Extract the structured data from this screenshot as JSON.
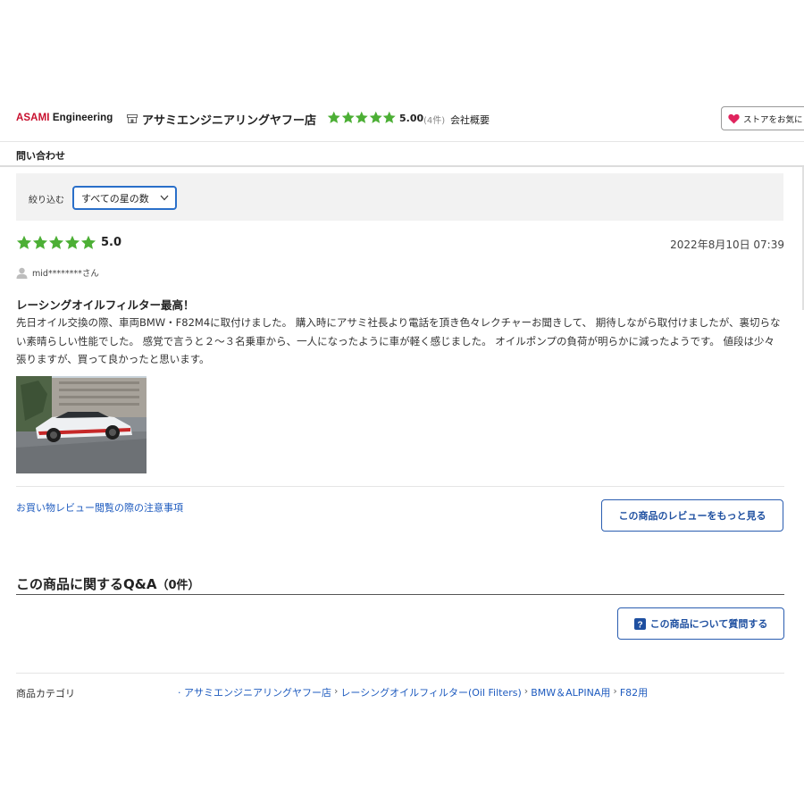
{
  "store": {
    "logo_part1": "ASAMI",
    "logo_part2": " Engineering",
    "icon": "store-icon",
    "name": "アサミエンジニアリングヤフー店",
    "rating": "5.00",
    "review_count": "(4件)",
    "company_link": "会社概要",
    "favorite_button": "ストアをお気に"
  },
  "nav": {
    "contact": "問い合わせ"
  },
  "filter": {
    "label": "絞り込む",
    "selected": "すべての星の数"
  },
  "review": {
    "rating": 5,
    "score": "5.0",
    "date": "2022年8月10日 07:39",
    "reviewer": "mid********さん",
    "title": "レーシングオイルフィルター最高！",
    "body": "先日オイル交換の際、車両BMW・F82M4に取付けました。 購入時にアサミ社長より電話を頂き色々レクチャーお聞きして、 期待しながら取付けましたが、裏切らない素晴らしい性能でした。 感覚で言うと２〜３名乗車から、一人になったように車が軽く感じました。 オイルポンプの負荷が明らかに減ったようです。 値段は少々張りますが、買って良かったと思います。"
  },
  "links": {
    "notice": "お買い物レビュー閲覧の際の注意事項",
    "more_reviews": "この商品のレビューをもっと見る"
  },
  "qa": {
    "heading": "この商品に関するQ&A",
    "count": "（0件）",
    "ask_button": "この商品について質問する"
  },
  "category": {
    "label": "商品カテゴリ",
    "path": [
      "· アサミエンジニアリングヤフー店",
      "レーシングオイルフィルター(Oil Filters)",
      "BMW＆ALPINA用",
      "F82用"
    ]
  },
  "colors": {
    "star": "#4caf35",
    "link": "#1e5bbf",
    "button_border": "#2a5db0",
    "select_border": "#2a6fc9",
    "heart": "#e0245e"
  }
}
